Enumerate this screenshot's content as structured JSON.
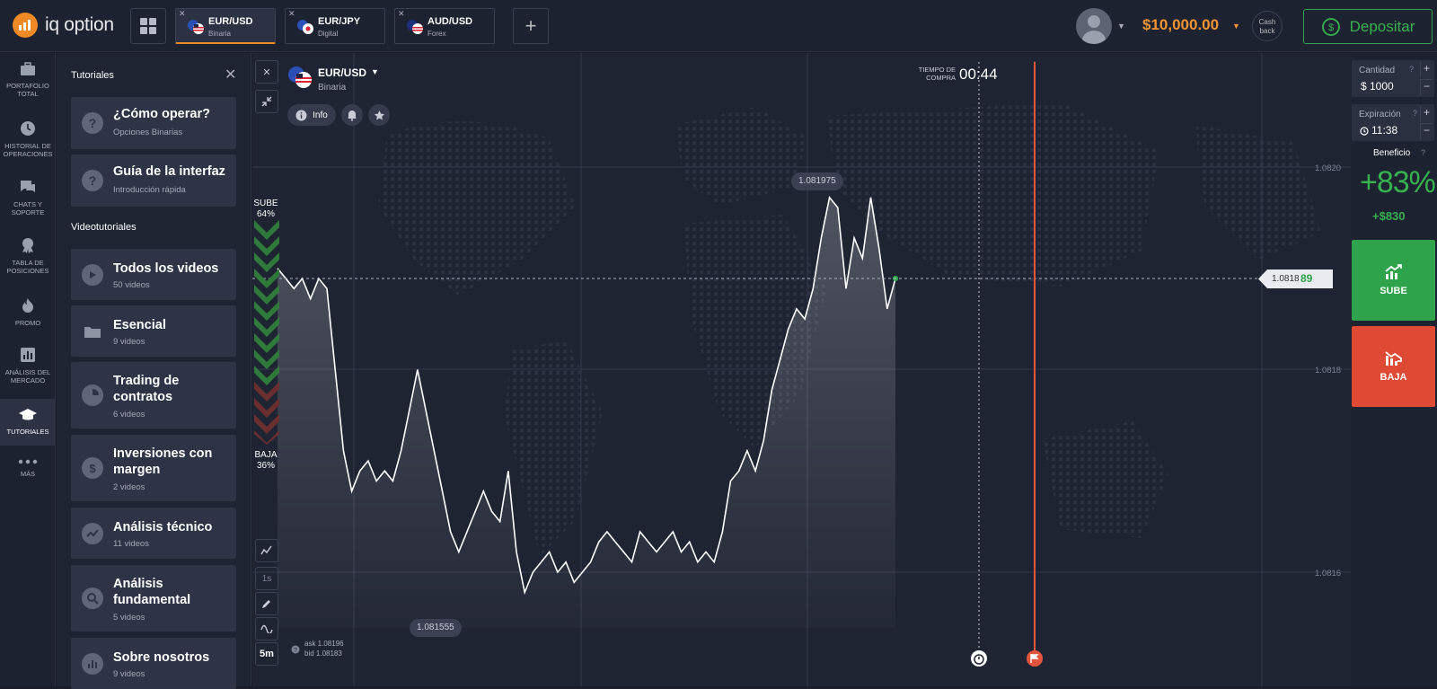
{
  "brand": {
    "logo_text": "iq option",
    "icon": "iq-option-logo-icon"
  },
  "tabs": [
    {
      "name": "EUR/USD",
      "type": "Binaria",
      "active": true
    },
    {
      "name": "EUR/JPY",
      "type": "Digital",
      "active": false
    },
    {
      "name": "AUD/USD",
      "type": "Forex",
      "active": false
    }
  ],
  "account": {
    "balance": "$10,000.00",
    "cashback": "Cash back",
    "deposit_label": "Depositar"
  },
  "leftnav": [
    {
      "label": "PORTAFOLIO TOTAL",
      "icon": "briefcase-icon"
    },
    {
      "label": "HISTORIAL DE OPERACIONES",
      "icon": "clock-icon"
    },
    {
      "label": "CHATS Y SOPORTE",
      "icon": "chat-icon"
    },
    {
      "label": "TABLA DE POSICIONES",
      "icon": "trophy-icon"
    },
    {
      "label": "PROMO",
      "icon": "flame-icon"
    },
    {
      "label": "ANÁLISIS DEL MERCADO",
      "icon": "bar-chart-icon"
    },
    {
      "label": "TUTORIALES",
      "icon": "graduation-cap-icon"
    },
    {
      "label": "MÁS",
      "icon": "more-dots-icon"
    }
  ],
  "tutorials": {
    "title": "Tutoriales",
    "cards_top": [
      {
        "title": "¿Cómo operar?",
        "subtitle": "Opciones Binarias",
        "icon": "question-icon"
      },
      {
        "title": "Guía de la interfaz",
        "subtitle": "Introducción rápida",
        "icon": "question-icon"
      }
    ],
    "section": "Videotutoriales",
    "cards": [
      {
        "title": "Todos los videos",
        "subtitle": "50 videos",
        "icon": "play-icon"
      },
      {
        "title": "Esencial",
        "subtitle": "9 videos",
        "icon": "folder-icon"
      },
      {
        "title": "Trading de contratos",
        "subtitle": "6 videos",
        "icon": "pie-icon"
      },
      {
        "title": "Inversiones con margen",
        "subtitle": "2 videos",
        "icon": "dollar-icon"
      },
      {
        "title": "Análisis técnico",
        "subtitle": "11 videos",
        "icon": "trend-icon"
      },
      {
        "title": "Análisis fundamental",
        "subtitle": "5 videos",
        "icon": "magnifier-icon"
      },
      {
        "title": "Sobre nosotros",
        "subtitle": "9 videos",
        "icon": "stats-icon"
      }
    ]
  },
  "asset": {
    "name": "EUR/USD",
    "type": "Binaria",
    "info": "Info"
  },
  "timer": {
    "label_line1": "TIEMPO DE",
    "label_line2": "COMPRA",
    "value": "00:44"
  },
  "sentiment": {
    "up_label": "SUBE",
    "up_pct": "64%",
    "down_label": "BAJA",
    "down_pct": "36%"
  },
  "chart_labels": {
    "high": "1.081975",
    "low": "1.081555",
    "current_main": "1.0818",
    "current_tail": "89",
    "ask": "ask 1.08196",
    "bid": "bid 1.08183",
    "timeframe_1": "1s",
    "timeframe_2": "5m"
  },
  "chart_data": {
    "type": "line",
    "y_ticks": [
      "1.0820",
      "1.0818",
      "1.0816"
    ],
    "ylim": [
      1.08155,
      1.08205
    ],
    "series": [
      {
        "values": [
          1.0819,
          1.08189,
          1.08188,
          1.08189,
          1.08187,
          1.08189,
          1.08188,
          1.0818,
          1.08172,
          1.08168,
          1.0817,
          1.08171,
          1.08169,
          1.0817,
          1.08169,
          1.08172,
          1.08176,
          1.0818,
          1.08176,
          1.08172,
          1.08168,
          1.08164,
          1.08162,
          1.08164,
          1.08166,
          1.08168,
          1.08166,
          1.08165,
          1.0817,
          1.08162,
          1.08158,
          1.0816,
          1.08161,
          1.08162,
          1.0816,
          1.08161,
          1.08159,
          1.0816,
          1.08161,
          1.08163,
          1.08164,
          1.08163,
          1.08162,
          1.08161,
          1.08164,
          1.08163,
          1.08162,
          1.08163,
          1.08164,
          1.08162,
          1.08163,
          1.08161,
          1.08162,
          1.08161,
          1.08164,
          1.08169,
          1.0817,
          1.08172,
          1.0817,
          1.08173,
          1.08178,
          1.08181,
          1.08184,
          1.08186,
          1.08185,
          1.08188,
          1.08193,
          1.08197,
          1.08196,
          1.08188,
          1.08193,
          1.08191,
          1.08197,
          1.08192,
          1.08186,
          1.08189
        ]
      }
    ]
  },
  "panel": {
    "amount_label": "Cantidad",
    "amount_value": "$ 1000",
    "expiry_label": "Expiración",
    "expiry_value": "11:38",
    "profit_label": "Beneficio",
    "profit_pct": "+83%",
    "profit_value": "+$830",
    "up_label": "SUBE",
    "down_label": "BAJA"
  },
  "colors": {
    "accent": "#f08a24",
    "up": "#2ea34b",
    "down": "#df4a34",
    "expiry_line": "#e5553d"
  }
}
